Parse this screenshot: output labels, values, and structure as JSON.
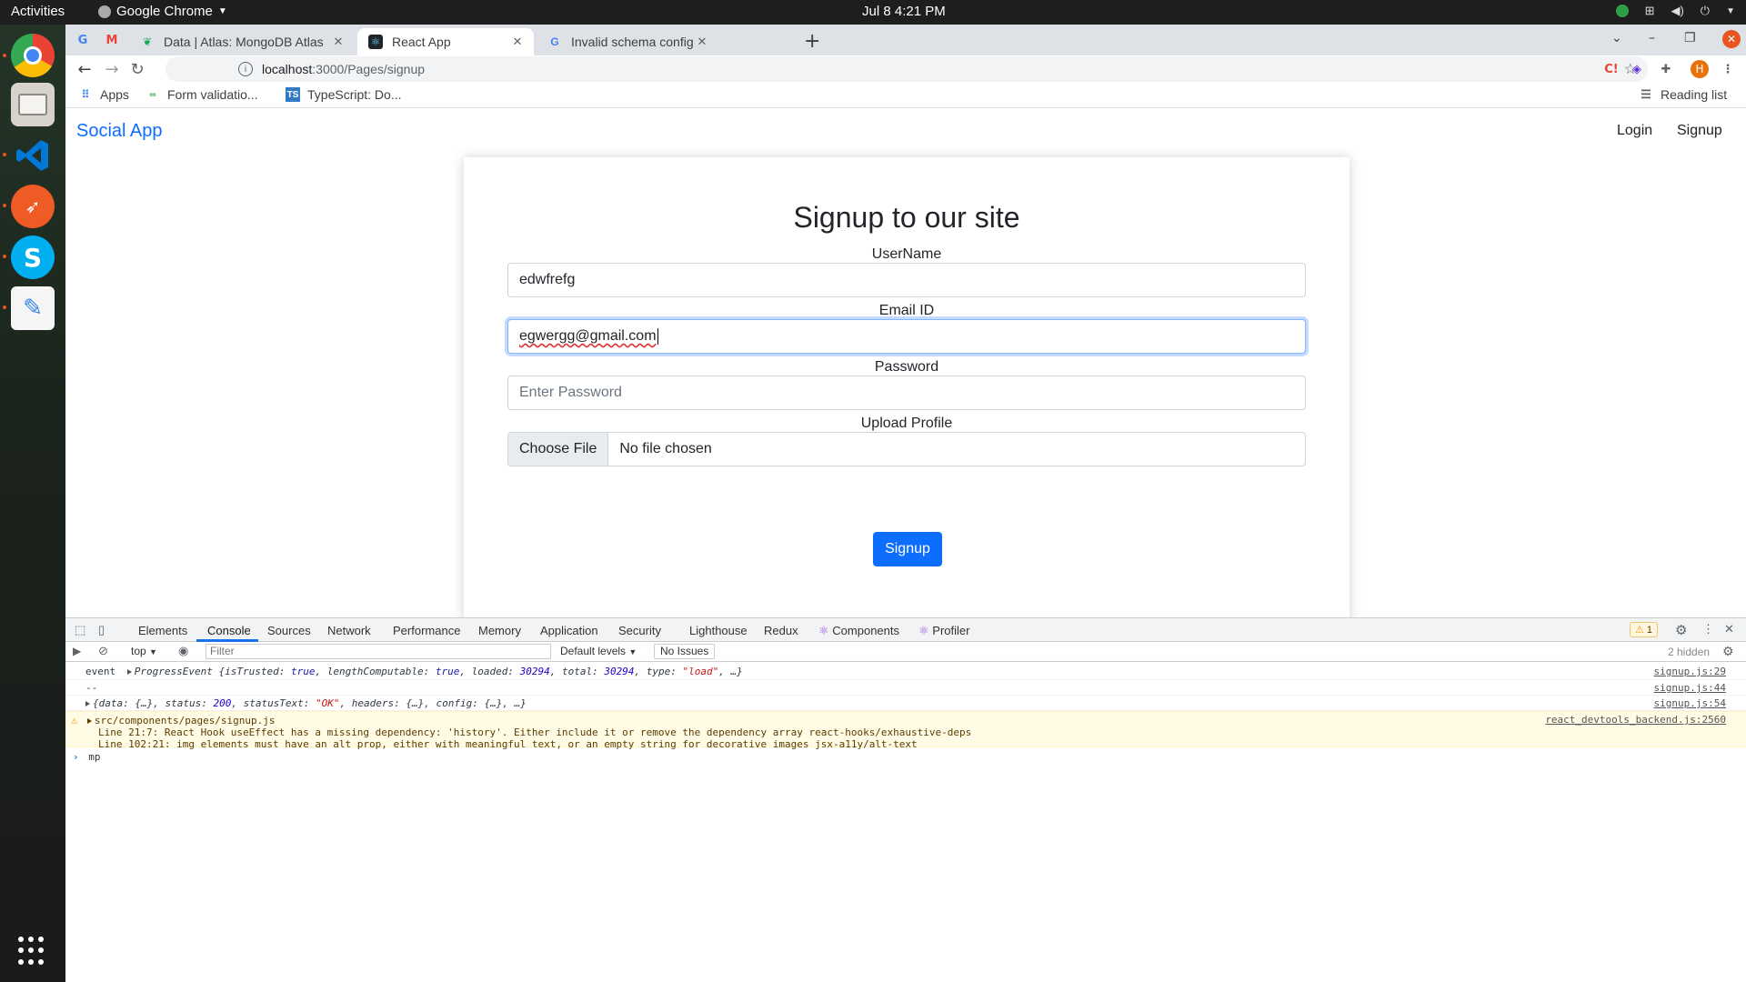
{
  "system": {
    "activities": "Activities",
    "app_name": "Google Chrome",
    "clock": "Jul 8  4:21 PM"
  },
  "tabs": [
    {
      "title": "Data | Atlas: MongoDB Atlas",
      "active": false
    },
    {
      "title": "React App",
      "active": true
    },
    {
      "title": "Invalid schema configuration",
      "active": false
    }
  ],
  "toolbar": {
    "url_host": "localhost",
    "url_path": ":3000/Pages/signup"
  },
  "bookmarks": {
    "apps": "Apps",
    "items": [
      "Form validatio...",
      "TypeScript: Do..."
    ],
    "reading_list": "Reading list"
  },
  "page": {
    "brand": "Social App",
    "nav": {
      "login": "Login",
      "signup": "Signup"
    },
    "heading": "Signup to our site",
    "username": {
      "label": "UserName",
      "value": "edwfrefg"
    },
    "email": {
      "label": "Email ID",
      "value": "egwergg@gmail.com"
    },
    "password": {
      "label": "Password",
      "placeholder": "Enter Password"
    },
    "upload": {
      "label": "Upload Profile",
      "button": "Choose File",
      "status": "No file chosen"
    },
    "submit": "Signup"
  },
  "devtools": {
    "tabs": [
      "Elements",
      "Console",
      "Sources",
      "Network",
      "Performance",
      "Memory",
      "Application",
      "Security",
      "Lighthouse",
      "Redux",
      "Components",
      "Profiler"
    ],
    "active_tab": "Console",
    "warning_count": "1",
    "context": "top",
    "filter_placeholder": "Filter",
    "levels": "Default levels",
    "issues": "No Issues",
    "hidden": "2 hidden",
    "console": {
      "line1": {
        "label": "event",
        "type": "ProgressEvent",
        "src": "signup.js:29"
      },
      "line2": {
        "text": "--",
        "src": "signup.js:44"
      },
      "line3": {
        "src": "signup.js:54"
      },
      "warning": {
        "file": "src/components/pages/signup.js",
        "src": "react_devtools_backend.js:2560",
        "detail1": "Line 21:7:    React Hook useEffect has a missing dependency: 'history'. Either include it or remove the dependency array  react-hooks/exhaustive-deps",
        "detail2": "Line 102:21:  img elements must have an alt prop, either with meaningful text, or an empty string for decorative images   jsx-a11y/alt-text"
      },
      "input": "mp"
    }
  }
}
